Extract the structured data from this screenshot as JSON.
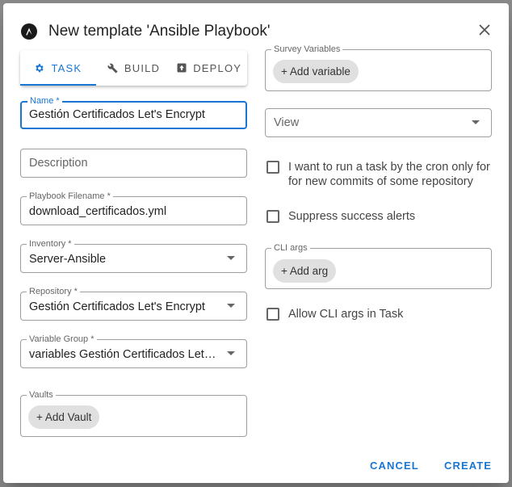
{
  "dialog": {
    "title": "New template 'Ansible Playbook'",
    "logo_icon": "ansible-logo-icon",
    "close_icon": "close-icon"
  },
  "tabs": [
    {
      "label": "TASK",
      "icon": "gear-icon",
      "active": true
    },
    {
      "label": "BUILD",
      "icon": "wrench-icon",
      "active": false
    },
    {
      "label": "DEPLOY",
      "icon": "deploy-icon",
      "active": false
    }
  ],
  "left": {
    "name": {
      "label": "Name *",
      "value": "Gestión Certificados Let's Encrypt"
    },
    "description": {
      "placeholder": "Description"
    },
    "playbook": {
      "label": "Playbook Filename *",
      "value": "download_certificados.yml"
    },
    "inventory": {
      "label": "Inventory *",
      "value": "Server-Ansible"
    },
    "repository": {
      "label": "Repository *",
      "value": "Gestión Certificados Let's Encrypt"
    },
    "variable_group": {
      "label": "Variable Group *",
      "value": "variables Gestión Certificados Let's Encrypt"
    },
    "vaults": {
      "label": "Vaults",
      "add_label": "+ Add Vault"
    }
  },
  "right": {
    "survey": {
      "label": "Survey Variables",
      "add_label": "+ Add variable"
    },
    "view": {
      "placeholder": "View"
    },
    "cron_check": {
      "label": "I want to run a task by the cron only for for new commits of some repository"
    },
    "suppress_check": {
      "label": "Suppress success alerts"
    },
    "cli_args": {
      "label": "CLI args",
      "add_label": "+ Add arg"
    },
    "allow_cli_check": {
      "label": "Allow CLI args in Task"
    }
  },
  "actions": {
    "cancel_label": "CANCEL",
    "create_label": "CREATE"
  },
  "colors": {
    "accent": "#1976d2",
    "chip": "#e0e0e0",
    "backdrop": "#8a8a8a"
  }
}
